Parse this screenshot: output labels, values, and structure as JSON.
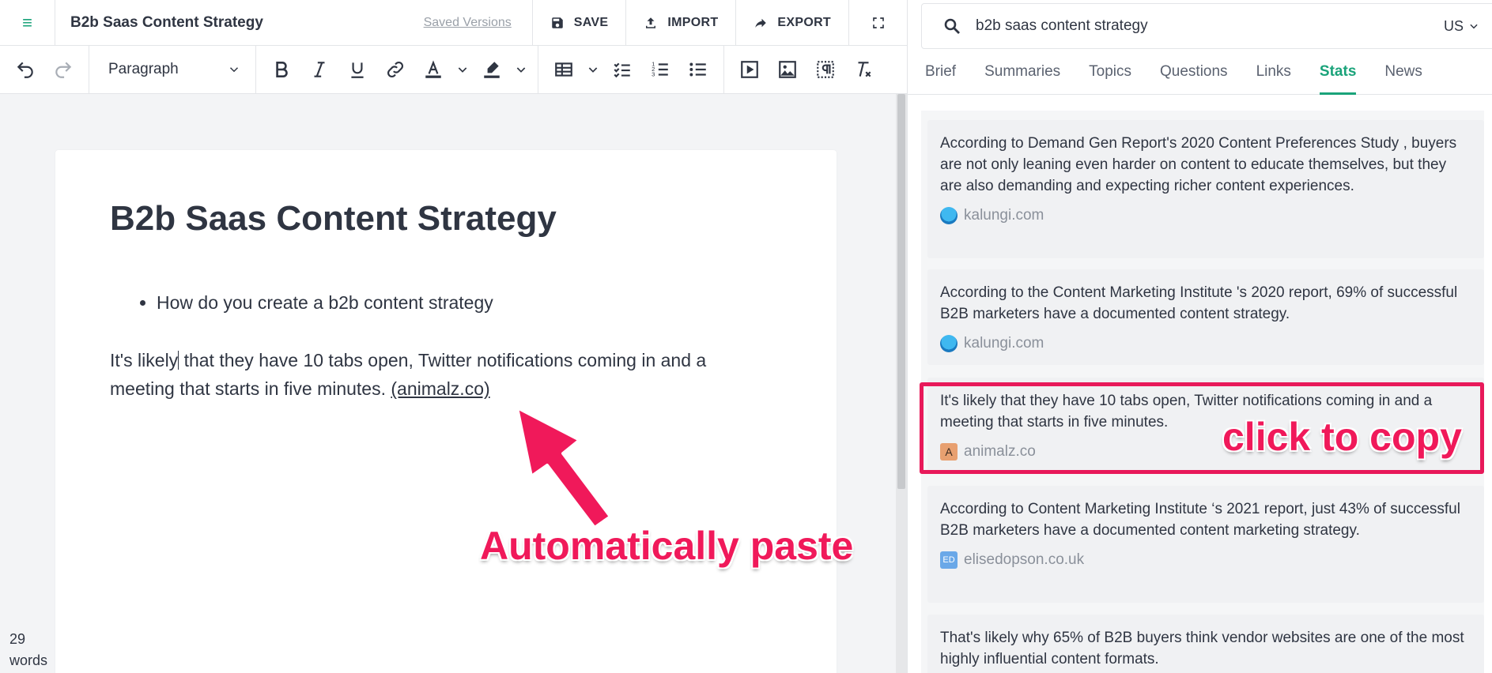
{
  "editor": {
    "doc_title": "B2b Saas Content Strategy",
    "saved_versions": "Saved Versions",
    "save_label": "SAVE",
    "import_label": "IMPORT",
    "export_label": "EXPORT",
    "paragraph_style": "Paragraph",
    "page_title": "B2b Saas Content Strategy",
    "bullets": [
      "How do you create a b2b content strategy"
    ],
    "body_before_caret": "It's likely",
    "body_after_caret": " that they have 10 tabs open, Twitter notifications coming in and a meeting that starts in five minutes. ",
    "body_link": "(animalz.co)",
    "word_count": "29",
    "word_count_unit": "words"
  },
  "research": {
    "search_value": "b2b saas content strategy",
    "country": "US",
    "tabs": [
      {
        "label": "Brief"
      },
      {
        "label": "Summaries"
      },
      {
        "label": "Topics"
      },
      {
        "label": "Questions"
      },
      {
        "label": "Links"
      },
      {
        "label": "Stats",
        "active": true
      },
      {
        "label": "News"
      }
    ],
    "cards": [
      {
        "text": "According to Demand Gen Report's 2020 Content Preferences Study , buyers are not only leaning even harder on content to educate themselves, but they are also demanding and expecting richer content experiences.",
        "source": "kalungi.com"
      },
      {
        "text": "According to the Content Marketing Institute 's 2020 report, 69% of successful B2B marketers have a documented content strategy.",
        "source": "kalungi.com"
      },
      {
        "text": "It's likely that they have 10 tabs open, Twitter notifications coming in and a meeting that starts in five minutes.",
        "source": "animalz.co",
        "favicon_letter": "A"
      },
      {
        "text": "According to Content Marketing Institute ‘s 2021 report, just 43% of successful B2B marketers have a documented content marketing strategy.",
        "source": "elisedopson.co.uk",
        "favicon_letter": "ED"
      },
      {
        "text": "That's likely why 65% of B2B buyers think vendor websites are one of the most highly influential content formats.",
        "source": ""
      }
    ]
  },
  "annotations": {
    "paste": "Automatically paste",
    "copy": "click to copy",
    "accent_color": "#f0195a"
  },
  "colors": {
    "brand_green": "#1aa37a",
    "text_dark": "#2f3542",
    "highlight_border": "#e8195a"
  }
}
